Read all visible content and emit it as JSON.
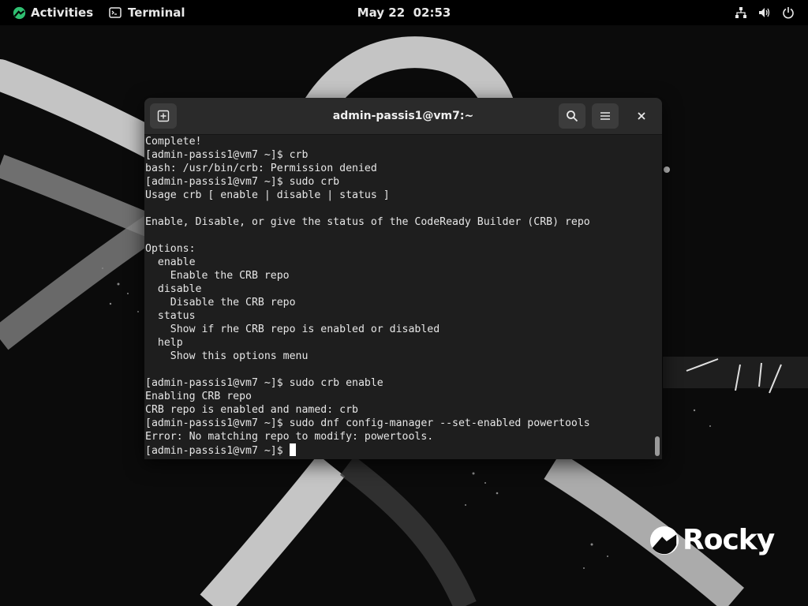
{
  "topbar": {
    "activities_label": "Activities",
    "app_name": "Terminal",
    "clock": "May 22  02:53",
    "tray_icons": [
      "network-icon",
      "volume-icon",
      "power-icon"
    ]
  },
  "window": {
    "title": "admin-passis1@vm7:~",
    "header_buttons": [
      "new-tab-icon",
      "search-icon",
      "hamburger-menu-icon",
      "close-icon"
    ]
  },
  "terminal": {
    "lines": [
      "Complete!",
      "[admin-passis1@vm7 ~]$ crb",
      "bash: /usr/bin/crb: Permission denied",
      "[admin-passis1@vm7 ~]$ sudo crb",
      "Usage crb [ enable | disable | status ]",
      "",
      "Enable, Disable, or give the status of the CodeReady Builder (CRB) repo",
      "",
      "Options:",
      "  enable",
      "    Enable the CRB repo",
      "  disable",
      "    Disable the CRB repo",
      "  status",
      "    Show if rhe CRB repo is enabled or disabled",
      "  help",
      "    Show this options menu",
      "",
      "[admin-passis1@vm7 ~]$ sudo crb enable",
      "Enabling CRB repo",
      "CRB repo is enabled and named: crb",
      "[admin-passis1@vm7 ~]$ sudo dnf config-manager --set-enabled powertools",
      "Error: No matching repo to modify: powertools."
    ],
    "prompt": "[admin-passis1@vm7 ~]$ ",
    "scroll_fraction_visible": 0.15
  },
  "wallpaper": {
    "logo_text": "Rocky",
    "colors": {
      "background": "#0b0b0b",
      "stroke": "#d9d9d9"
    }
  }
}
